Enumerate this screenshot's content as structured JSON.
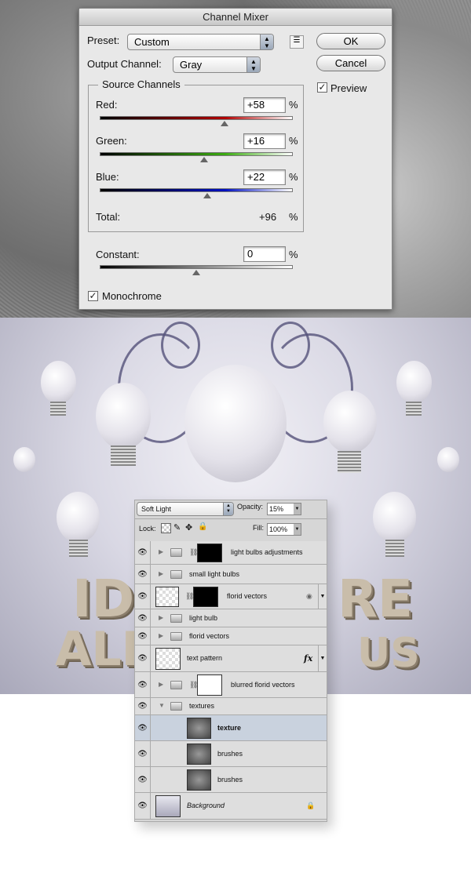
{
  "dialog": {
    "title": "Channel Mixer",
    "preset_label": "Preset:",
    "preset_value": "Custom",
    "output_label": "Output Channel:",
    "output_value": "Gray",
    "ok": "OK",
    "cancel": "Cancel",
    "preview_label": "Preview",
    "preview_checked": true,
    "source_title": "Source Channels",
    "channels": [
      {
        "label": "Red:",
        "value": "+58",
        "numeric": 58,
        "pct": "%"
      },
      {
        "label": "Green:",
        "value": "+16",
        "numeric": 16,
        "pct": "%"
      },
      {
        "label": "Blue:",
        "value": "+22",
        "numeric": 22,
        "pct": "%"
      }
    ],
    "total_label": "Total:",
    "total_value": "+96",
    "total_pct": "%",
    "constant_label": "Constant:",
    "constant_value": "0",
    "constant_numeric": 0,
    "constant_pct": "%",
    "monochrome_label": "Monochrome",
    "monochrome_checked": true,
    "slider_range": [
      -200,
      200
    ]
  },
  "artwork": {
    "text_fragments": [
      "ID",
      "RE",
      "ALL",
      "US"
    ]
  },
  "layers": {
    "blend_mode": "Soft Light",
    "opacity_label": "Opacity:",
    "opacity": "15%",
    "lock_label": "Lock:",
    "fill_label": "Fill:",
    "fill": "100%",
    "items": [
      {
        "name": "light bulbs adjustments",
        "type": "group",
        "mask": true
      },
      {
        "name": "small light bulbs",
        "type": "group"
      },
      {
        "name": "florid vectors",
        "type": "smart",
        "mask": true,
        "badge": "smart-filter-icon"
      },
      {
        "name": "light bulb",
        "type": "group"
      },
      {
        "name": "florid vectors",
        "type": "group"
      },
      {
        "name": "text pattern",
        "type": "layer",
        "badge": "fx"
      },
      {
        "name": "blurred florid vectors",
        "type": "group",
        "mask": true
      },
      {
        "name": "textures",
        "type": "group-open"
      },
      {
        "name": "texture",
        "type": "layer",
        "selected": true
      },
      {
        "name": "brushes",
        "type": "layer"
      },
      {
        "name": "brushes",
        "type": "layer"
      },
      {
        "name": "Background",
        "type": "background",
        "locked": true
      }
    ]
  }
}
